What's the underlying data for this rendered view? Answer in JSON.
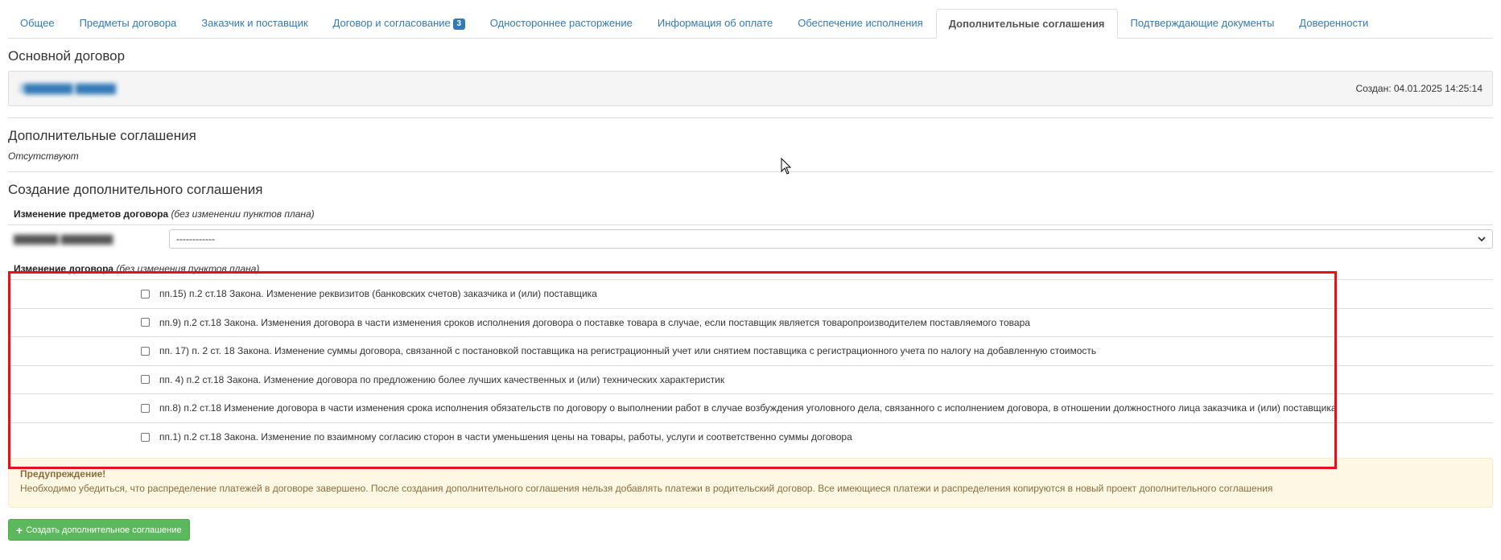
{
  "tabs": [
    {
      "label": "Общее"
    },
    {
      "label": "Предметы договора"
    },
    {
      "label": "Заказчик и поставщик"
    },
    {
      "label": "Договор и согласование",
      "badge": "3"
    },
    {
      "label": "Одностороннее расторжение"
    },
    {
      "label": "Информация об оплате"
    },
    {
      "label": "Обеспечение исполнения"
    },
    {
      "label": "Дополнительные соглашения",
      "active": true
    },
    {
      "label": "Подтверждающие документы"
    },
    {
      "label": "Доверенности"
    }
  ],
  "main_contract": {
    "title": "Основной договор",
    "link_text": "2▇▇▇▇▇▇ ▇▇▇▇▇",
    "created": "Создан: 04.01.2025 14:25:14"
  },
  "additional": {
    "title": "Дополнительные соглашения",
    "status": "Отсутствуют"
  },
  "creation": {
    "title": "Создание дополнительного соглашения",
    "subjects_header": {
      "bold": "Изменение предметов договора",
      "italic": "(без изменении пунктов плана)"
    },
    "subjects_select_label": "▇▇▇▇▇▇ ▇▇▇▇▇▇▇",
    "subjects_select_value": "------------",
    "contract_header": {
      "bold": "Изменение договора",
      "italic": "(без изменения пунктов плана)"
    },
    "options": [
      "пп.15) п.2 ст.18 Закона. Изменение реквизитов (банковских счетов) заказчика и (или) поставщика",
      "пп.9) п.2 ст.18 Закона. Изменения договора в части изменения сроков исполнения договора о поставке товара в случае, если поставщик является товаропроизводителем поставляемого товара",
      "пп. 17) п. 2 ст. 18 Закона. Изменение суммы договора, связанной с постановкой поставщика на регистрационный учет или снятием поставщика с регистрационного учета по налогу на добавленную стоимость",
      "пп. 4) п.2 ст.18 Закона. Изменение договора по предложению более лучших качественных и (или) технических характеристик",
      "пп.8) п.2 ст.18 Изменение договора в части изменения срока исполнения обязательств по договору о выполнении работ в случае возбуждения уголовного дела, связанного с исполнением договора, в отношении должностного лица заказчика и (или) поставщика",
      "пп.1) п.2 ст.18 Закона. Изменение по взаимному согласию сторон в части уменьшения цены на товары, работы, услуги и соответственно суммы договора"
    ]
  },
  "warning": {
    "title": "Предупреждение!",
    "text": "Необходимо убедиться, что распределение платежей в договоре завершено. После создания дополнительного соглашения нельзя добавлять платежи в родительский договор. Все имеющиеся платежи и распределения копируются в новый проект дополнительного соглашения"
  },
  "create_button": {
    "label": "Создать дополнительное соглашение",
    "icon": "plus-icon"
  },
  "colors": {
    "link": "#337ab7",
    "highlight": "#e8101a",
    "success": "#5cb85c",
    "warning_bg": "#fcf8e3"
  }
}
